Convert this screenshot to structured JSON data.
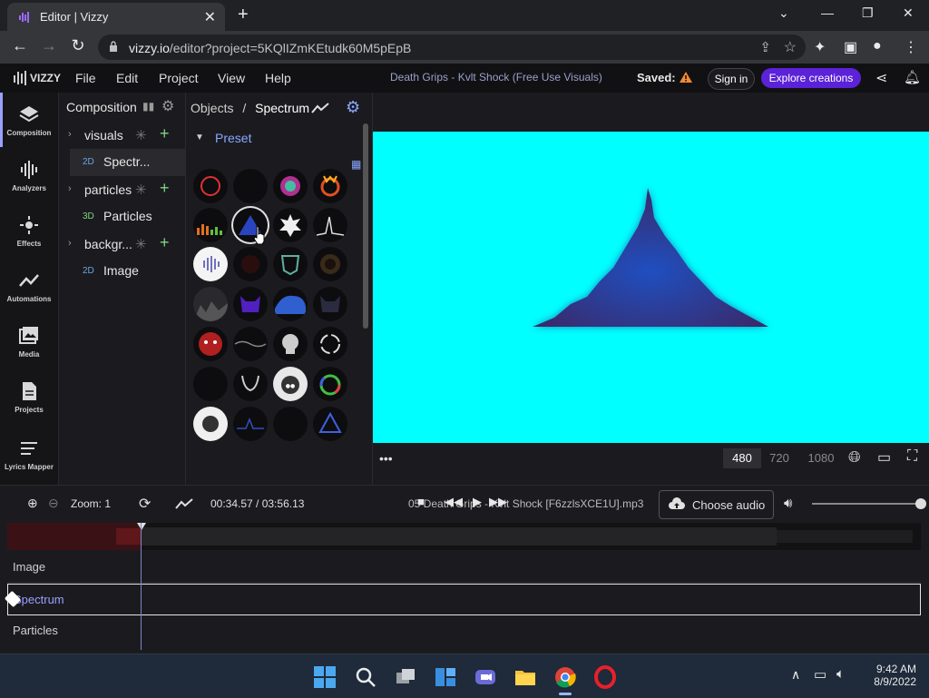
{
  "browser": {
    "tab_title": "Editor | Vizzy",
    "url_host": "vizzy.io",
    "url_path": "/editor?project=5KQlIZmKEtudk60M5pEpB"
  },
  "app": {
    "logo": "VIZZY",
    "menu": [
      "File",
      "Edit",
      "Project",
      "View",
      "Help"
    ],
    "song_title": "Death Grips - Kvlt Shock (Free Use Visuals)",
    "saved_label": "Saved:",
    "sign_in": "Sign in",
    "explore": "Explore creations"
  },
  "rail": [
    "Composition",
    "Analyzers",
    "Effects",
    "Automations",
    "Media",
    "Projects",
    "Lyrics Mapper"
  ],
  "composition": {
    "title": "Composition",
    "groups": [
      {
        "label": "visuals",
        "child_tag": "2D",
        "child": "Spectr..."
      },
      {
        "label": "particles",
        "child_tag": "3D",
        "child": "Particles"
      },
      {
        "label": "backgr...",
        "child_tag": "2D",
        "child": "Image"
      }
    ]
  },
  "objects": {
    "breadcrumb_root": "Objects",
    "breadcrumb_sep": "/",
    "breadcrumb_current": "Spectrum",
    "preset_label": "Preset"
  },
  "preview": {
    "canvas_color": "#00ffff",
    "qualities": [
      "480",
      "720",
      "1080"
    ],
    "selected_quality": "480"
  },
  "timeline": {
    "zoom_label": "Zoom: 1",
    "time": "00:34.57 / 03:56.13",
    "file": "05 Death Grips - Kvlt Shock [F6zzlsXCE1U].mp3",
    "choose_audio": "Choose audio",
    "volume": 1.0,
    "tracks": [
      "Image",
      "Spectrum",
      "Particles"
    ]
  },
  "taskbar": {
    "time": "9:42 AM",
    "date": "8/9/2022"
  }
}
